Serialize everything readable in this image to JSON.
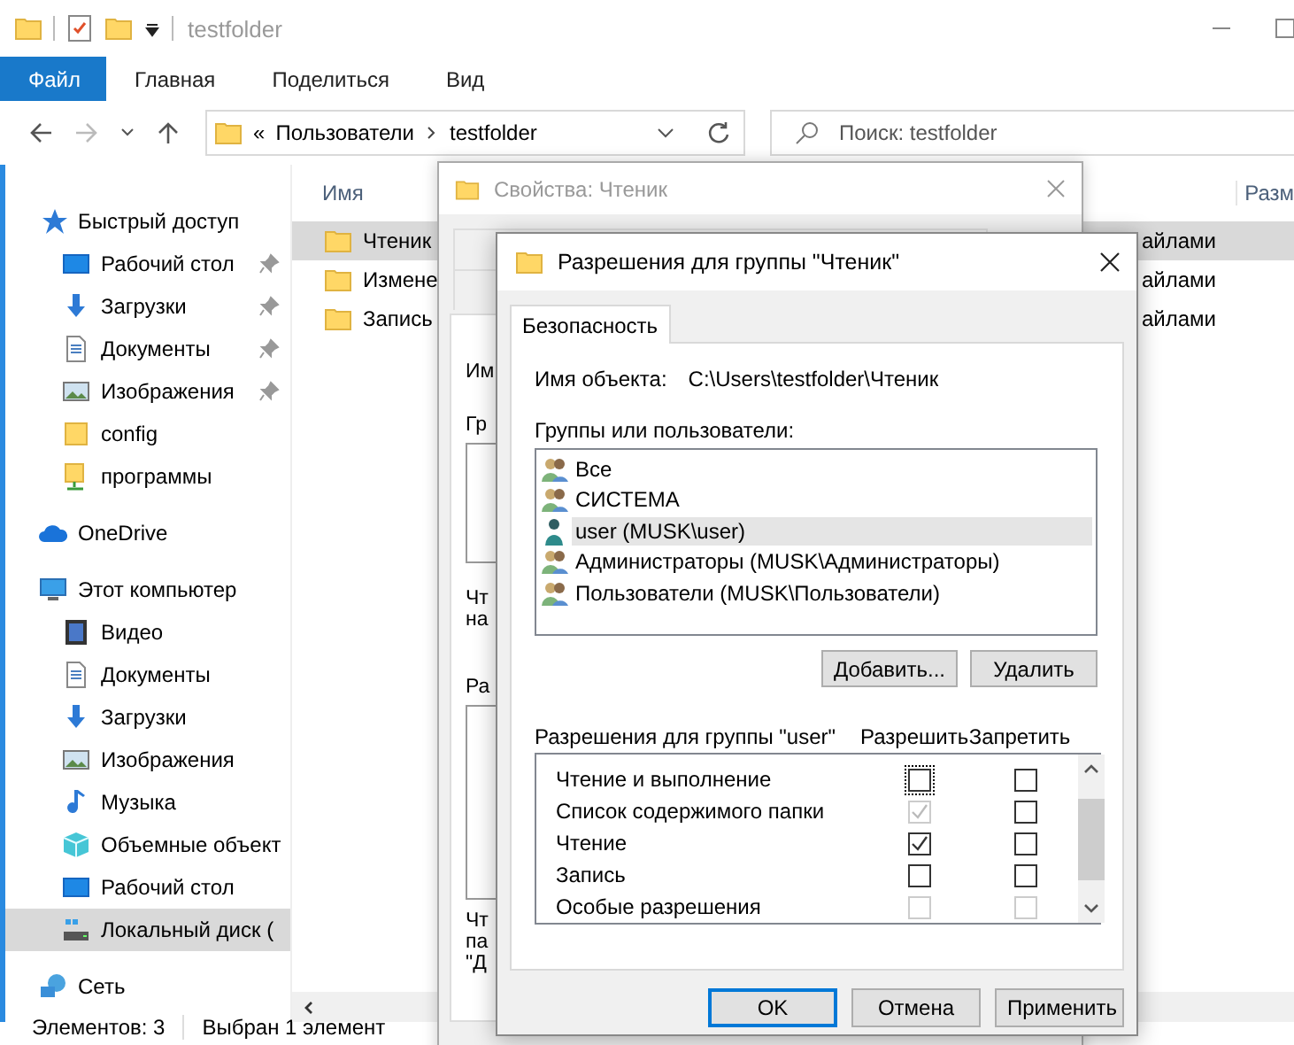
{
  "window": {
    "title": "testfolder"
  },
  "ribbon_tabs": [
    {
      "label": "Файл",
      "selected": true
    },
    {
      "label": "Главная",
      "selected": false
    },
    {
      "label": "Поделиться",
      "selected": false
    },
    {
      "label": "Вид",
      "selected": false
    }
  ],
  "address_bar": {
    "overflow": "«",
    "path": [
      "Пользователи",
      "testfolder"
    ]
  },
  "search": {
    "placeholder": "Поиск: testfolder"
  },
  "sidebar": {
    "sections": [
      {
        "label": "Быстрый доступ",
        "selected": false,
        "children": [
          {
            "label": "Рабочий стол",
            "pinned": true,
            "selected": false
          },
          {
            "label": "Загрузки",
            "pinned": true,
            "selected": false
          },
          {
            "label": "Документы",
            "pinned": true,
            "selected": false
          },
          {
            "label": "Изображения",
            "pinned": true,
            "selected": false
          },
          {
            "label": "config",
            "pinned": false,
            "selected": false
          },
          {
            "label": "программы",
            "pinned": false,
            "selected": false
          }
        ]
      },
      {
        "label": "OneDrive",
        "selected": false
      },
      {
        "label": "Этот компьютер",
        "selected": false,
        "children": [
          {
            "label": "Видео",
            "pinned": false,
            "selected": false
          },
          {
            "label": "Документы",
            "pinned": false,
            "selected": false
          },
          {
            "label": "Загрузки",
            "pinned": false,
            "selected": false
          },
          {
            "label": "Изображения",
            "pinned": false,
            "selected": false
          },
          {
            "label": "Музыка",
            "pinned": false,
            "selected": false
          },
          {
            "label": "Объемные объект",
            "pinned": false,
            "selected": false
          },
          {
            "label": "Рабочий стол",
            "pinned": false,
            "selected": false
          },
          {
            "label": "Локальный диск (",
            "pinned": false,
            "selected": true
          }
        ]
      },
      {
        "label": "Сеть",
        "selected": false
      }
    ]
  },
  "file_list": {
    "columns": [
      "Имя",
      "Разм"
    ],
    "rows": [
      {
        "name": "Чтеник",
        "column_3": "айлами",
        "selected": true
      },
      {
        "name": "Измене",
        "column_3": "айлами",
        "selected": false
      },
      {
        "name": "Запись",
        "column_3": "айлами",
        "selected": false
      }
    ]
  },
  "status_bar": {
    "item_count": "Элементов: 3",
    "selection": "Выбран 1 элемент"
  },
  "properties_dialog": {
    "title": "Свойства: Чтеник",
    "fragments": [
      "Им",
      "Гр",
      "Чт",
      "на",
      "Ра",
      "Чт",
      "па",
      "\"Д"
    ]
  },
  "permissions_dialog": {
    "title": "Разрешения для группы \"Чтеник\"",
    "tab": "Безопасность",
    "object_label": "Имя объекта:",
    "object_path": "C:\\Users\\testfolder\\Чтеник",
    "groups_label": "Группы или пользователи:",
    "principals": [
      {
        "name": "Все",
        "kind": "group",
        "selected": false
      },
      {
        "name": "СИСТЕМА",
        "kind": "group",
        "selected": false
      },
      {
        "name": "user (MUSK\\user)",
        "kind": "user",
        "selected": true
      },
      {
        "name": "Администраторы (MUSK\\Администраторы)",
        "kind": "group",
        "selected": false
      },
      {
        "name": "Пользователи (MUSK\\Пользователи)",
        "kind": "group",
        "selected": false
      }
    ],
    "principal_buttons": [
      "Добавить...",
      "Удалить"
    ],
    "permissions_label": "Разрешения для группы \"user\"",
    "allow_label": "Разрешить",
    "deny_label": "Запретить",
    "permissions": [
      {
        "name": "Чтение и выполнение",
        "allow_checked": false,
        "allow_disabled": false,
        "allow_focused": true,
        "deny_checked": false,
        "deny_disabled": false
      },
      {
        "name": "Список содержимого папки",
        "allow_checked": true,
        "allow_disabled": true,
        "allow_focused": false,
        "deny_checked": false,
        "deny_disabled": false
      },
      {
        "name": "Чтение",
        "allow_checked": true,
        "allow_disabled": false,
        "allow_focused": false,
        "deny_checked": false,
        "deny_disabled": false
      },
      {
        "name": "Запись",
        "allow_checked": false,
        "allow_disabled": false,
        "allow_focused": false,
        "deny_checked": false,
        "deny_disabled": false
      },
      {
        "name": "Особые разрешения",
        "allow_checked": false,
        "allow_disabled": true,
        "allow_focused": false,
        "deny_checked": false,
        "deny_disabled": true
      }
    ],
    "buttons": [
      {
        "label": "OK",
        "default": true
      },
      {
        "label": "Отмена",
        "default": false
      },
      {
        "label": "Применить",
        "default": false
      }
    ]
  }
}
